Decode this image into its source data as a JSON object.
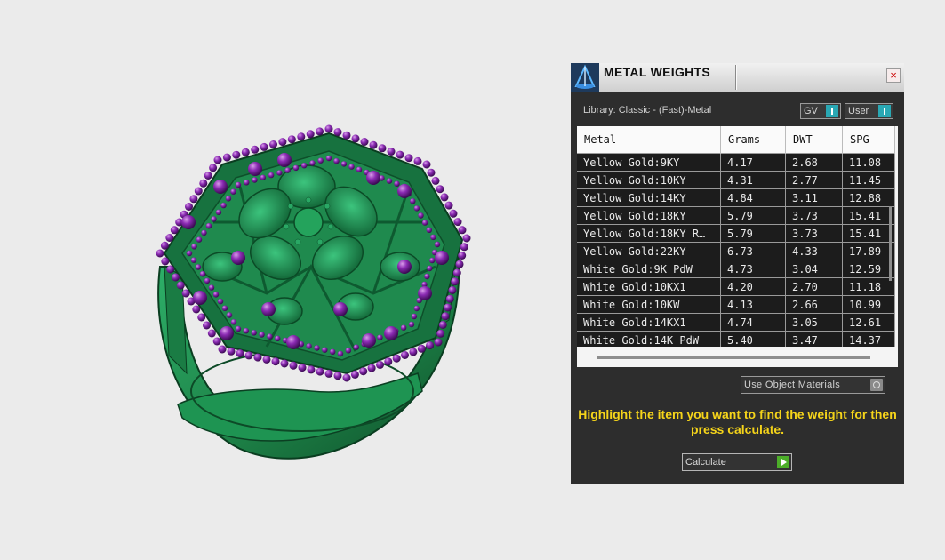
{
  "panel": {
    "title": "METAL WEIGHTS",
    "close_label": "×",
    "library_label": "Library: Classic - (Fast)-Metal",
    "toggles": {
      "gv": "GV",
      "user": "User"
    },
    "table": {
      "columns": [
        "Metal",
        "Grams",
        "DWT",
        "SPG"
      ],
      "rows": [
        [
          "Yellow Gold:9KY",
          "4.17",
          "2.68",
          "11.08"
        ],
        [
          "Yellow Gold:10KY",
          "4.31",
          "2.77",
          "11.45"
        ],
        [
          "Yellow Gold:14KY",
          "4.84",
          "3.11",
          "12.88"
        ],
        [
          "Yellow Gold:18KY",
          "5.79",
          "3.73",
          "15.41"
        ],
        [
          "Yellow Gold:18KY R…",
          "5.79",
          "3.73",
          "15.41"
        ],
        [
          "Yellow Gold:22KY",
          "6.73",
          "4.33",
          "17.89"
        ],
        [
          "White Gold:9K PdW",
          "4.73",
          "3.04",
          "12.59"
        ],
        [
          "White Gold:10KX1",
          "4.20",
          "2.70",
          "11.18"
        ],
        [
          "White Gold:10KW",
          "4.13",
          "2.66",
          "10.99"
        ],
        [
          "White Gold:14KX1",
          "4.74",
          "3.05",
          "12.61"
        ],
        [
          "White Gold:14K PdW",
          "5.40",
          "3.47",
          "14.37"
        ]
      ]
    },
    "use_object_materials": "Use Object Materials",
    "instruction": "Highlight the item you want to find the weight for then press calculate.",
    "calculate_label": "Calculate"
  },
  "colors": {
    "ring_metal": "#1f8a4e",
    "gem_purple": "#7a1fa0",
    "instruction_text": "#f5d41a",
    "toggle_accent": "#29a8b4",
    "calculate_accent": "#4cae29"
  }
}
